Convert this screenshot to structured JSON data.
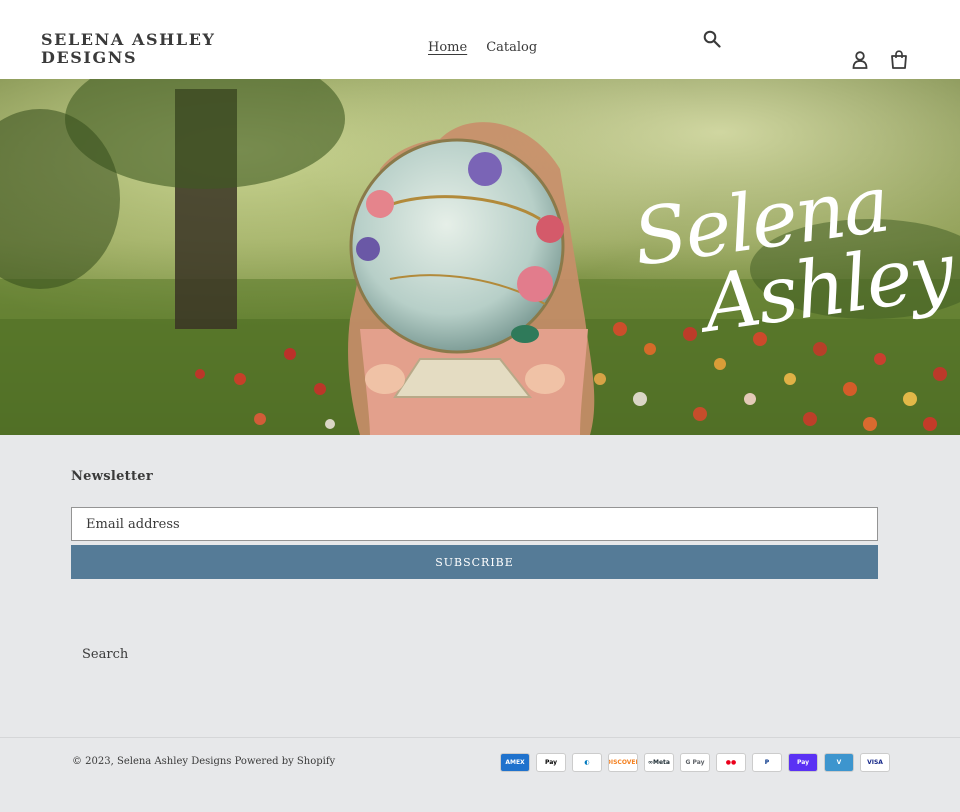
{
  "stray_text": "\"> \">",
  "header": {
    "brand": "SELENA ASHLEY DESIGNS",
    "nav": [
      {
        "label": "Home"
      },
      {
        "label": "Catalog"
      }
    ],
    "icons": {
      "search": "search-icon",
      "account": "account-icon",
      "cart": "cart-icon"
    }
  },
  "hero": {
    "script_line1": "Selena",
    "script_line2": "Ashley"
  },
  "newsletter": {
    "title": "Newsletter",
    "email_placeholder": "Email address",
    "subscribe_label": "SUBSCRIBE"
  },
  "footer": {
    "links": [
      {
        "label": "Search"
      }
    ],
    "copyright": "© 2023, Selena Ashley Designs Powered by Shopify",
    "payments": [
      {
        "name": "American Express",
        "label": "AMEX",
        "bg": "#1f72cd",
        "fg": "#ffffff"
      },
      {
        "name": "Apple Pay",
        "label": "Pay",
        "bg": "#ffffff",
        "fg": "#000000"
      },
      {
        "name": "Diners Club",
        "label": "◐",
        "bg": "#ffffff",
        "fg": "#0079be"
      },
      {
        "name": "Discover",
        "label": "DISCOVER",
        "bg": "#ffffff",
        "fg": "#f48120"
      },
      {
        "name": "Meta Pay",
        "label": "∞Meta",
        "bg": "#ffffff",
        "fg": "#1c2b33"
      },
      {
        "name": "Google Pay",
        "label": "G Pay",
        "bg": "#ffffff",
        "fg": "#5f6368"
      },
      {
        "name": "Mastercard",
        "label": "●●",
        "bg": "#ffffff",
        "fg": "#eb001b"
      },
      {
        "name": "PayPal",
        "label": "P",
        "bg": "#ffffff",
        "fg": "#003087"
      },
      {
        "name": "Shop Pay",
        "label": "Pay",
        "bg": "#5a31f4",
        "fg": "#ffffff"
      },
      {
        "name": "Venmo",
        "label": "V",
        "bg": "#3d95ce",
        "fg": "#ffffff"
      },
      {
        "name": "Visa",
        "label": "VISA",
        "bg": "#ffffff",
        "fg": "#142688"
      }
    ]
  }
}
